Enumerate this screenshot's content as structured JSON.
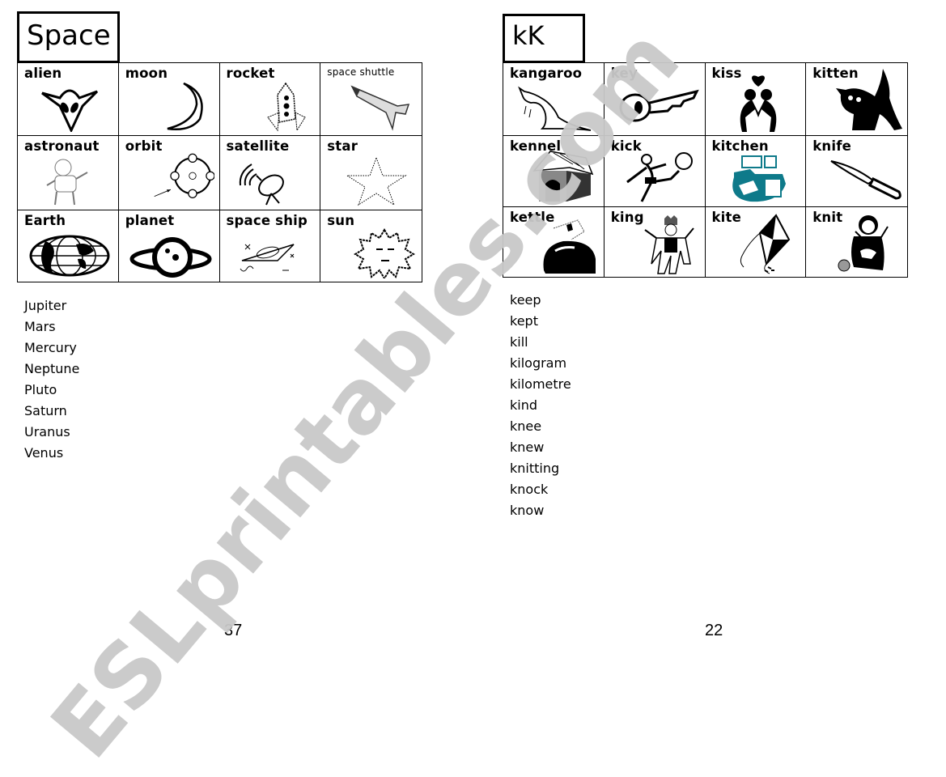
{
  "left_page": {
    "title": "Space",
    "cells": [
      {
        "label": "alien",
        "icon": "alien-icon"
      },
      {
        "label": "moon",
        "icon": "moon-icon"
      },
      {
        "label": "rocket",
        "icon": "rocket-icon"
      },
      {
        "label": "space shuttle",
        "icon": "space-shuttle-icon"
      },
      {
        "label": "astronaut",
        "icon": "astronaut-icon"
      },
      {
        "label": "orbit",
        "icon": "orbit-icon"
      },
      {
        "label": "satellite",
        "icon": "satellite-icon"
      },
      {
        "label": "star",
        "icon": "star-icon"
      },
      {
        "label": "Earth",
        "icon": "earth-icon"
      },
      {
        "label": "planet",
        "icon": "planet-icon"
      },
      {
        "label": "space ship",
        "icon": "space-ship-icon"
      },
      {
        "label": "sun",
        "icon": "sun-icon"
      }
    ],
    "words": [
      "Jupiter",
      "Mars",
      "Mercury",
      "Neptune",
      "Pluto",
      "Saturn",
      "Uranus",
      "Venus"
    ],
    "page_number": "37"
  },
  "right_page": {
    "title": "kK",
    "cells": [
      {
        "label": "kangaroo",
        "icon": "kangaroo-icon"
      },
      {
        "label": "key",
        "icon": "key-icon"
      },
      {
        "label": "kiss",
        "icon": "kiss-icon"
      },
      {
        "label": "kitten",
        "icon": "kitten-icon"
      },
      {
        "label": "kennel",
        "icon": "kennel-icon"
      },
      {
        "label": "kick",
        "icon": "kick-icon"
      },
      {
        "label": "kitchen",
        "icon": "kitchen-icon"
      },
      {
        "label": "knife",
        "icon": "knife-icon"
      },
      {
        "label": "kettle",
        "icon": "kettle-icon"
      },
      {
        "label": "king",
        "icon": "king-icon"
      },
      {
        "label": "kite",
        "icon": "kite-icon"
      },
      {
        "label": "knit",
        "icon": "knit-icon"
      }
    ],
    "words": [
      "keep",
      "kept",
      "kill",
      "kilogram",
      "kilometre",
      "kind",
      "knee",
      "knew",
      "knitting",
      "knock",
      "know"
    ],
    "page_number": "22"
  },
  "watermark": "ESLprintables.com",
  "colors": {
    "kitchen_teal": "#0e7a8a",
    "watermark_gray": "#c9c9c9"
  }
}
